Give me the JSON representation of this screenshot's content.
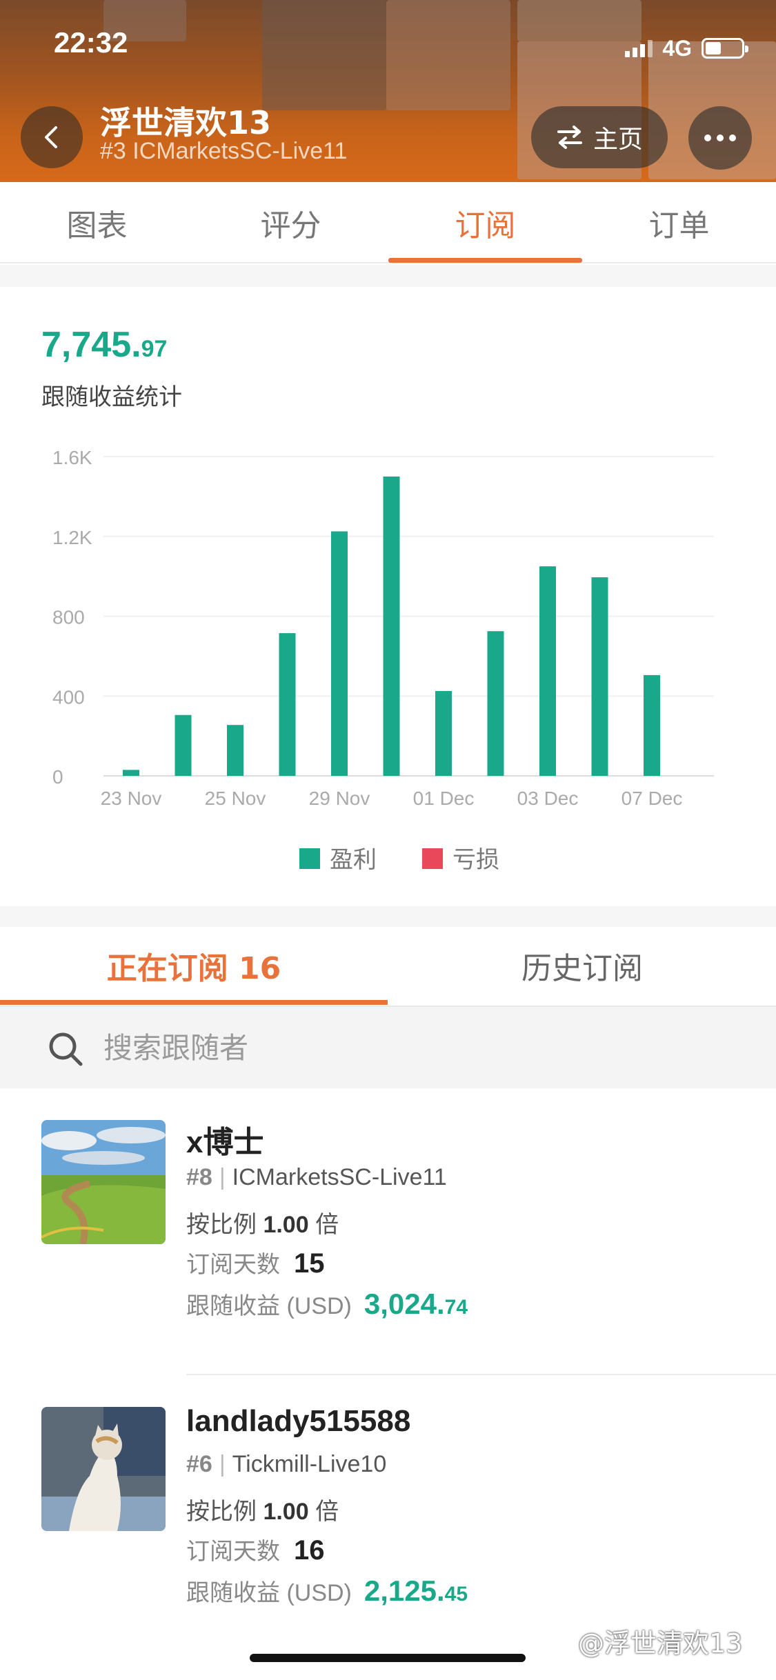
{
  "status_bar": {
    "time": "22:32",
    "network": "4G"
  },
  "header": {
    "title": "浮世清欢13",
    "subtitle": "#3 ICMarketsSC-Live11",
    "home_label": "主页"
  },
  "tabs": [
    {
      "label": "图表"
    },
    {
      "label": "评分"
    },
    {
      "label": "订阅"
    },
    {
      "label": "订单"
    }
  ],
  "stats": {
    "total_main": "7,745.",
    "total_decimal": "97",
    "label": "跟随收益统计"
  },
  "chart_data": {
    "type": "bar",
    "y_ticks": [
      "0",
      "400",
      "800",
      "1.2K",
      "1.6K"
    ],
    "ylim": [
      0,
      1600
    ],
    "x_tick_labels": [
      "23 Nov",
      "25 Nov",
      "29 Nov",
      "01 Dec",
      "03 Dec",
      "07 Dec"
    ],
    "values": [
      30,
      305,
      255,
      715,
      1225,
      1500,
      425,
      725,
      1050,
      995,
      505
    ],
    "grid": true,
    "legend": [
      {
        "name": "盈利",
        "color": "#1aa88a"
      },
      {
        "name": "亏损",
        "color": "#e8485a"
      }
    ],
    "legend_position": "bottom"
  },
  "subtabs": [
    {
      "label": "正在订阅 16"
    },
    {
      "label": "历史订阅"
    }
  ],
  "search": {
    "placeholder": "搜索跟随者"
  },
  "followers": [
    {
      "name": "x博士",
      "rank": "#8",
      "server": "ICMarketsSC-Live11",
      "ratio_prefix": "按比例",
      "ratio": "1.00",
      "ratio_suffix": "倍",
      "days_label": "订阅天数",
      "days": "15",
      "profit_label": "跟随收益 (USD)",
      "profit_main": "3,024.",
      "profit_decimal": "74"
    },
    {
      "name": "landlady515588",
      "rank": "#6",
      "server": "Tickmill-Live10",
      "ratio_prefix": "按比例",
      "ratio": "1.00",
      "ratio_suffix": "倍",
      "days_label": "订阅天数",
      "days": "16",
      "profit_label": "跟随收益 (USD)",
      "profit_main": "2,125.",
      "profit_decimal": "45"
    }
  ],
  "watermark": "@浮世清欢13"
}
